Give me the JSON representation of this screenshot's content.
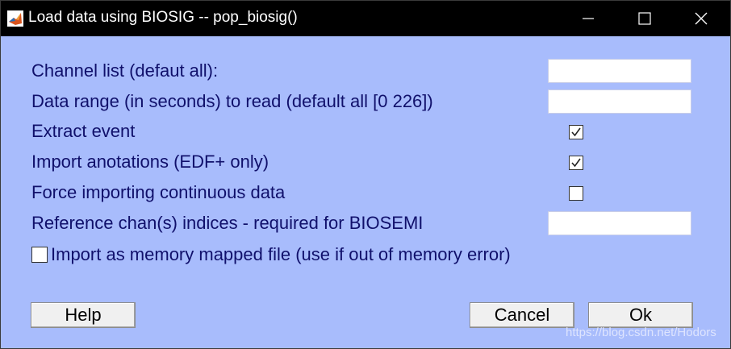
{
  "window": {
    "title": "Load data using BIOSIG -- pop_biosig()",
    "app_icon": "matlab-icon",
    "controls": [
      "minimize-icon",
      "maximize-icon",
      "close-icon"
    ]
  },
  "fields": {
    "channel_list": {
      "label": "Channel list (defaut all):",
      "value": ""
    },
    "data_range": {
      "label": "Data range (in seconds) to read (default all [0 226])",
      "value": ""
    },
    "extract_event": {
      "label": "Extract event",
      "checked": true
    },
    "import_annotations": {
      "label": "Import anotations (EDF+ only)",
      "checked": true
    },
    "force_continuous": {
      "label": "Force importing continuous data",
      "checked": false
    },
    "reference_chan": {
      "label": "Reference chan(s) indices - required for BIOSEMI",
      "value": ""
    },
    "memory_mapped": {
      "label": "Import as memory mapped file (use if out of memory error)",
      "checked": false
    }
  },
  "buttons": {
    "help": "Help",
    "cancel": "Cancel",
    "ok": "Ok"
  },
  "watermark": "https://blog.csdn.net/Hodors",
  "colors": {
    "background": "#a8bcfc",
    "label_text": "#10106b",
    "titlebar": "#000000"
  }
}
